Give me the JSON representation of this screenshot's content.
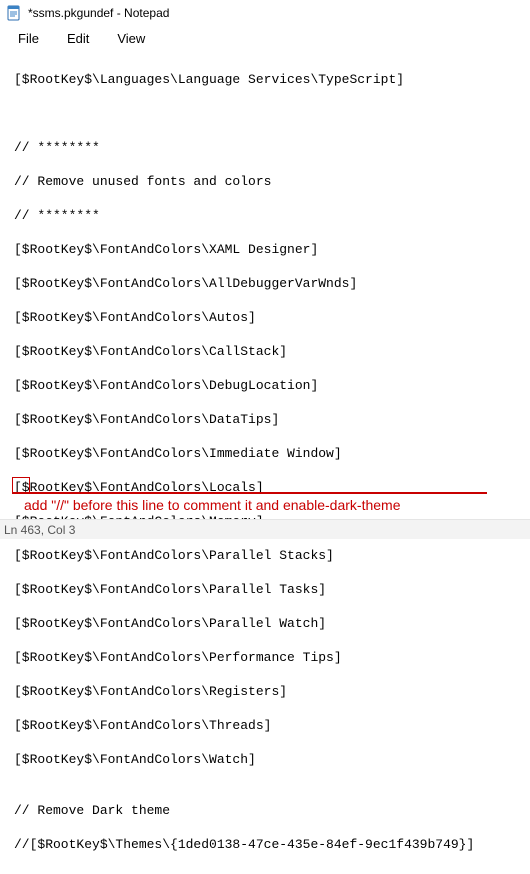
{
  "window": {
    "title": "*ssms.pkgundef - Notepad"
  },
  "menu": {
    "file": "File",
    "edit": "Edit",
    "view": "View"
  },
  "lines": {
    "l0": "[$RootKey$\\Languages\\Language Services\\TypeScript]",
    "l1": "",
    "l2": "",
    "l3": "// ********",
    "l4": "// Remove unused fonts and colors",
    "l5": "// ********",
    "l6": "[$RootKey$\\FontAndColors\\XAML Designer]",
    "l7": "[$RootKey$\\FontAndColors\\AllDebuggerVarWnds]",
    "l8": "[$RootKey$\\FontAndColors\\Autos]",
    "l9": "[$RootKey$\\FontAndColors\\CallStack]",
    "l10": "[$RootKey$\\FontAndColors\\DebugLocation]",
    "l11": "[$RootKey$\\FontAndColors\\DataTips]",
    "l12": "[$RootKey$\\FontAndColors\\Immediate Window]",
    "l13": "[$RootKey$\\FontAndColors\\Locals]",
    "l14": "[$RootKey$\\FontAndColors\\Memory]",
    "l15": "[$RootKey$\\FontAndColors\\Parallel Stacks]",
    "l16": "[$RootKey$\\FontAndColors\\Parallel Tasks]",
    "l17": "[$RootKey$\\FontAndColors\\Parallel Watch]",
    "l18": "[$RootKey$\\FontAndColors\\Performance Tips]",
    "l19": "[$RootKey$\\FontAndColors\\Registers]",
    "l20": "[$RootKey$\\FontAndColors\\Threads]",
    "l21": "[$RootKey$\\FontAndColors\\Watch]",
    "l22": "",
    "l23": "// Remove Dark theme",
    "l24": "//[$RootKey$\\Themes\\{1ded0138-47ce-435e-84ef-9ec1f439b749}]"
  },
  "annotation": {
    "text": "add \"//\" before this line to comment it and enable-dark-theme"
  },
  "status": {
    "pos": "Ln 463, Col 3"
  },
  "colors": {
    "highlight": "#c80000"
  }
}
